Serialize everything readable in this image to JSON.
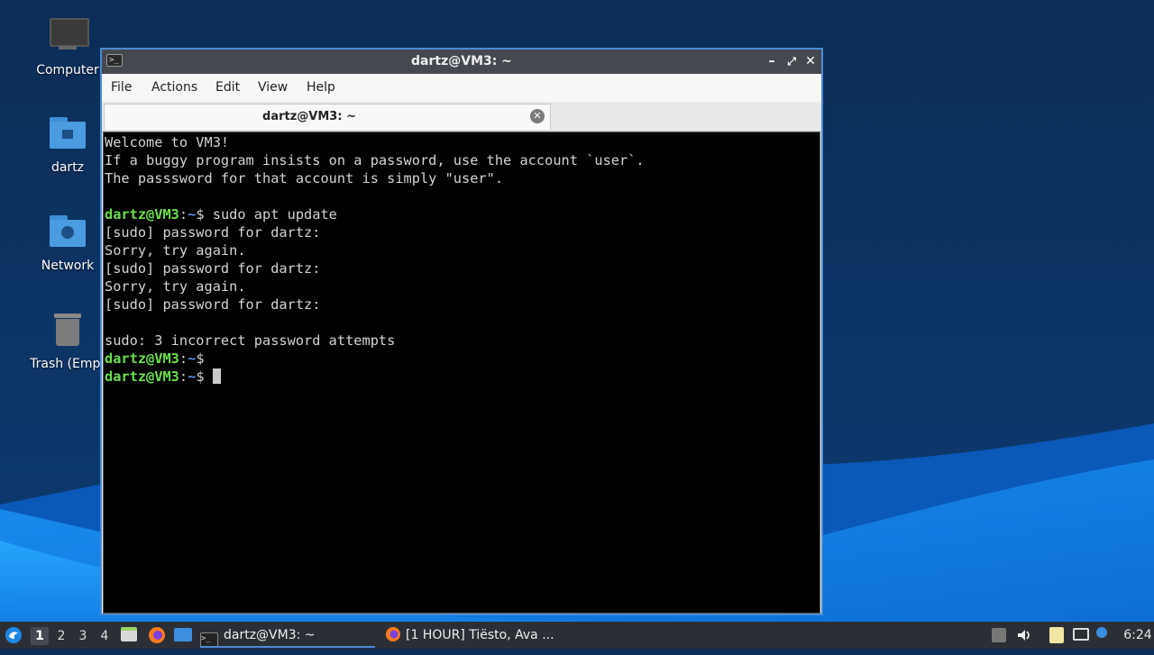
{
  "desktop": {
    "icons": [
      {
        "label": "Computer",
        "icon": "computer-icon"
      },
      {
        "label": "dartz",
        "icon": "home-folder-icon"
      },
      {
        "label": "Network",
        "icon": "network-folder-icon"
      },
      {
        "label": "Trash (Empt",
        "icon": "trash-icon"
      }
    ]
  },
  "window": {
    "title": "dartz@VM3: ~",
    "app_icon": ">_",
    "controls": {
      "minimize": "–",
      "maximize": "⤢",
      "close": "✕"
    },
    "menu": [
      "File",
      "Actions",
      "Edit",
      "View",
      "Help"
    ],
    "tab": {
      "label": "dartz@VM3: ~",
      "close": "✕"
    }
  },
  "terminal": {
    "lines": [
      {
        "text": "Welcome to VM3!"
      },
      {
        "text": "If a buggy program insists on a password, use the account `user`."
      },
      {
        "text": "The passsword for that account is simply \"user\"."
      },
      {
        "text": ""
      },
      {
        "user": "dartz@VM3",
        "path": "~",
        "symbol": "$ ",
        "command": "sudo apt update"
      },
      {
        "text": "[sudo] password for dartz:"
      },
      {
        "text": "Sorry, try again."
      },
      {
        "text": "[sudo] password for dartz:"
      },
      {
        "text": "Sorry, try again."
      },
      {
        "text": "[sudo] password for dartz:"
      },
      {
        "text": ""
      },
      {
        "text": "sudo: 3 incorrect password attempts"
      },
      {
        "user": "dartz@VM3",
        "path": "~",
        "symbol": "$",
        "command": ""
      },
      {
        "user": "dartz@VM3",
        "path": "~",
        "symbol": "$ ",
        "command": "",
        "cursor": true
      }
    ],
    "colors": {
      "background": "#000000",
      "text": "#d3d3d3",
      "user": "#6ae04a",
      "path": "#5c8fe6"
    }
  },
  "taskbar": {
    "workspaces": [
      "1",
      "2",
      "3",
      "4"
    ],
    "active_workspace": "1",
    "tasks": [
      {
        "label": "dartz@VM3: ~",
        "icon": "terminal-icon",
        "active": true
      },
      {
        "label": "[1 HOUR] Tiësto, Ava ...",
        "icon": "firefox-icon",
        "active": false
      }
    ],
    "launchers": [
      "file-manager-icon",
      "firefox-icon",
      "desktop-icon"
    ],
    "clock": "6:24"
  },
  "colors": {
    "accent": "#4b8ad6",
    "taskbar": "#2b2f35",
    "wallpaper": "#0b2d57"
  }
}
